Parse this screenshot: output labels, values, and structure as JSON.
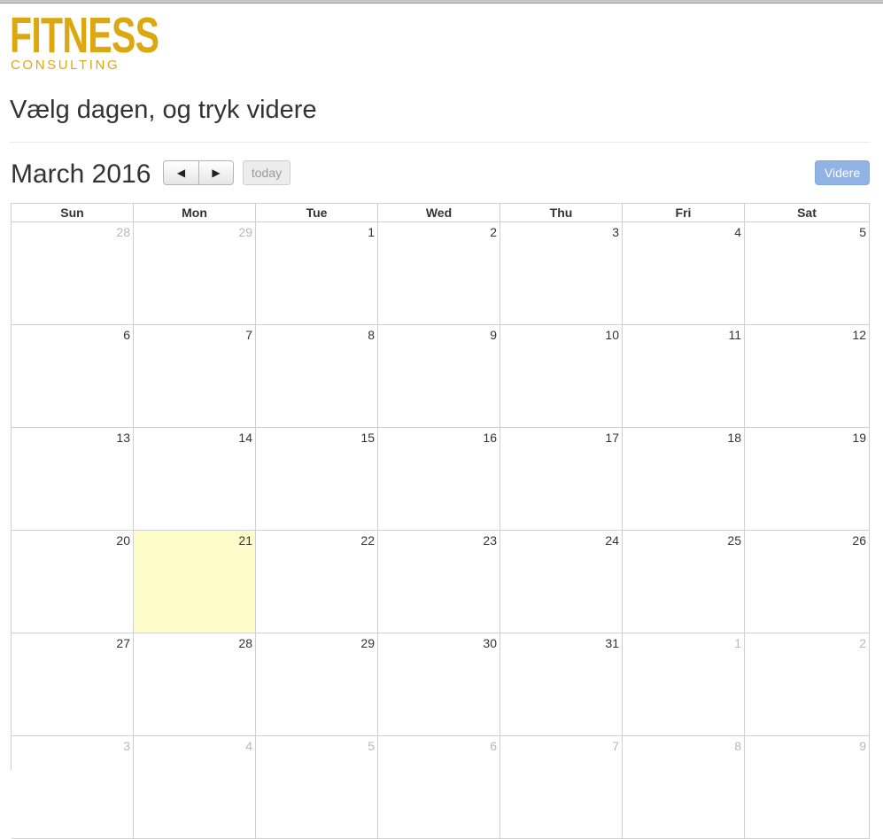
{
  "logo": {
    "main": "FITNESS",
    "sub": "CONSULTING",
    "color": "#dca811"
  },
  "page": {
    "title": "Vælg dagen, og tryk videre"
  },
  "calendar": {
    "month_title": "March 2016",
    "prev_label": "◀",
    "next_label": "▶",
    "today_label": "today",
    "next_button_label": "Videre",
    "weekdays": [
      "Sun",
      "Mon",
      "Tue",
      "Wed",
      "Thu",
      "Fri",
      "Sat"
    ],
    "today_highlight_color": "#fefcc8",
    "weeks": [
      [
        {
          "day": "28",
          "other": true
        },
        {
          "day": "29",
          "other": true
        },
        {
          "day": "1"
        },
        {
          "day": "2"
        },
        {
          "day": "3"
        },
        {
          "day": "4"
        },
        {
          "day": "5"
        }
      ],
      [
        {
          "day": "6"
        },
        {
          "day": "7"
        },
        {
          "day": "8"
        },
        {
          "day": "9"
        },
        {
          "day": "10"
        },
        {
          "day": "11"
        },
        {
          "day": "12"
        }
      ],
      [
        {
          "day": "13"
        },
        {
          "day": "14"
        },
        {
          "day": "15"
        },
        {
          "day": "16"
        },
        {
          "day": "17"
        },
        {
          "day": "18"
        },
        {
          "day": "19"
        }
      ],
      [
        {
          "day": "20"
        },
        {
          "day": "21",
          "today": true
        },
        {
          "day": "22"
        },
        {
          "day": "23"
        },
        {
          "day": "24"
        },
        {
          "day": "25"
        },
        {
          "day": "26"
        }
      ],
      [
        {
          "day": "27"
        },
        {
          "day": "28"
        },
        {
          "day": "29"
        },
        {
          "day": "30"
        },
        {
          "day": "31"
        },
        {
          "day": "1",
          "other": true
        },
        {
          "day": "2",
          "other": true
        }
      ],
      [
        {
          "day": "3",
          "other": true
        },
        {
          "day": "4",
          "other": true
        },
        {
          "day": "5",
          "other": true
        },
        {
          "day": "6",
          "other": true
        },
        {
          "day": "7",
          "other": true
        },
        {
          "day": "8",
          "other": true
        },
        {
          "day": "9",
          "other": true
        }
      ]
    ]
  }
}
